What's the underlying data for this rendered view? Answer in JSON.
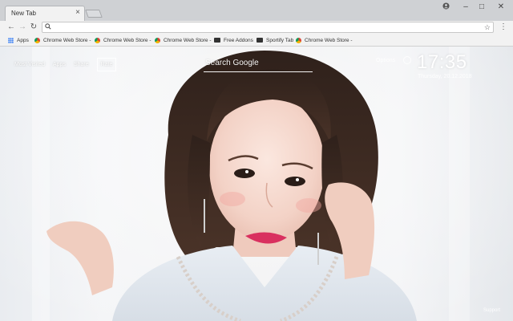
{
  "window": {
    "tab_title": "New Tab",
    "tab_close_icon": "close-icon",
    "controls": {
      "account_icon": "account-icon",
      "minimize": "–",
      "maximize": "□",
      "close": "✕"
    }
  },
  "toolbar": {
    "back": "←",
    "forward": "→",
    "reload": "↻",
    "address_value": "",
    "search_icon": "🔍",
    "star": "☆",
    "menu": "⋮"
  },
  "bookmarks": [
    {
      "label": "Apps",
      "icon": "apps-grid-icon"
    },
    {
      "label": "Chrome Web Store -",
      "icon": "chrome-web-store-icon"
    },
    {
      "label": "Chrome Web Store -",
      "icon": "chrome-web-store-icon"
    },
    {
      "label": "Chrome Web Store -",
      "icon": "chrome-web-store-icon"
    },
    {
      "label": "Free Addons",
      "icon": "addon-icon"
    },
    {
      "label": "Sportify Tab",
      "icon": "chrome-web-store-icon"
    },
    {
      "label": "Chrome Web Store -",
      "icon": "chrome-web-store-icon"
    }
  ],
  "newtab": {
    "nav": {
      "most_visited": "Most Visited",
      "apps": "Apps",
      "share": "Share",
      "rate": "Rate"
    },
    "search_placeholder": "Search Google",
    "options": "Options",
    "clock": "17:35",
    "date": "Thursday, 20.12.2018",
    "support": "Support"
  },
  "colors": {
    "frame": "#cfd1d4",
    "toolbar": "#f2f2f2",
    "hair": "#3a2a22",
    "lips": "#d9305f"
  }
}
